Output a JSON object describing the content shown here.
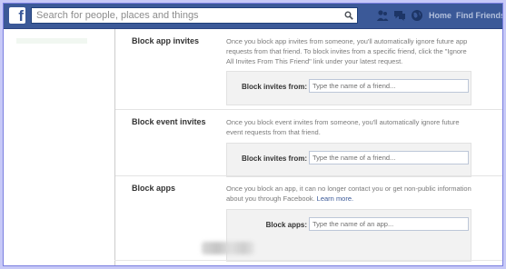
{
  "topbar": {
    "logo": "f",
    "search_placeholder": "Search for people, places and things",
    "nav": {
      "home": "Home",
      "find_friends": "Find Friends"
    },
    "colors": {
      "bar": "#3b5998",
      "frame": "#c7c9f7"
    }
  },
  "sections": [
    {
      "title": "Block app invites",
      "description": "Once you block app invites from someone, you'll automatically ignore future app requests from that friend. To block invites from a specific friend, click the \"Ignore All Invites From This Friend\" link under your latest request.",
      "field_label": "Block invites from:",
      "field_placeholder": "Type the name of a friend..."
    },
    {
      "title": "Block event invites",
      "description": "Once you block event invites from someone, you'll automatically ignore future event requests from that friend.",
      "field_label": "Block invites from:",
      "field_placeholder": "Type the name of a friend..."
    },
    {
      "title": "Block apps",
      "description": "Once you block an app, it can no longer contact you or get non-public information about you through Facebook.",
      "learn_more": "Learn more.",
      "field_label": "Block apps:",
      "field_placeholder": "Type the name of an app..."
    }
  ]
}
